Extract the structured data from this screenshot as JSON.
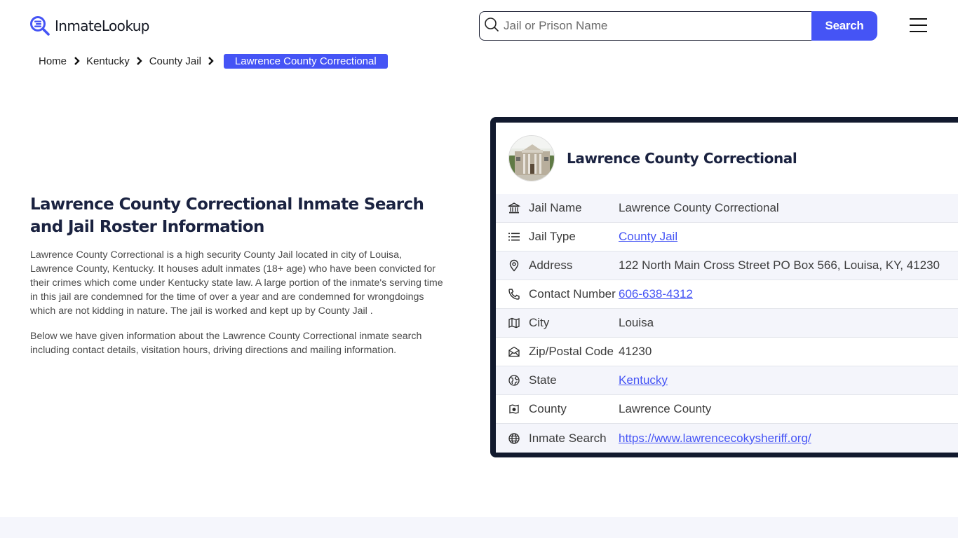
{
  "header": {
    "logo_text": "InmateLookup",
    "search": {
      "placeholder": "Jail or Prison Name",
      "value": "",
      "button_label": "Search"
    }
  },
  "breadcrumb": {
    "items": [
      "Home",
      "Kentucky",
      "County Jail"
    ],
    "current": "Lawrence County Correctional"
  },
  "main": {
    "title": "Lawrence County Correctional Inmate Search and Jail Roster Information",
    "paragraphs": [
      "Lawrence County Correctional is a high security County Jail located in city of Louisa, Lawrence County, Kentucky. It houses adult inmates (18+ age) who have been convicted for their crimes which come under Kentucky state law. A large portion of the inmate's serving time in this jail are condemned for the time of over a year and are condemned for wrongdoings which are not kidding in nature. The jail is worked and kept up by County Jail .",
      "Below we have given information about the Lawrence County Correctional inmate search including contact details, visitation hours, driving directions and mailing information."
    ]
  },
  "card": {
    "title": "Lawrence County Correctional",
    "rows": [
      {
        "icon": "bank-icon",
        "label": "Jail Name",
        "value": "Lawrence County Correctional",
        "link": false
      },
      {
        "icon": "list-icon",
        "label": "Jail Type",
        "value": "County Jail",
        "link": true
      },
      {
        "icon": "map-pin-icon",
        "label": "Address",
        "value": "122 North Main Cross Street PO Box 566, Louisa, KY, 41230",
        "link": false
      },
      {
        "icon": "phone-icon",
        "label": "Contact Number",
        "value": "606-638-4312",
        "link": true
      },
      {
        "icon": "map-icon",
        "label": "City",
        "value": "Louisa",
        "link": false
      },
      {
        "icon": "mail-open-icon",
        "label": "Zip/Postal Code",
        "value": "41230",
        "link": false
      },
      {
        "icon": "globe-region-icon",
        "label": "State",
        "value": "Kentucky",
        "link": true
      },
      {
        "icon": "county-map-icon",
        "label": "County",
        "value": "Lawrence County",
        "link": false
      },
      {
        "icon": "globe-icon",
        "label": "Inmate Search",
        "value": "https://www.lawrencecokysheriff.org/",
        "link": true
      }
    ]
  },
  "colors": {
    "accent": "#4554f5",
    "card_border": "#121a2e",
    "heading": "#1a2240",
    "row_alt": "#f4f5fb"
  }
}
